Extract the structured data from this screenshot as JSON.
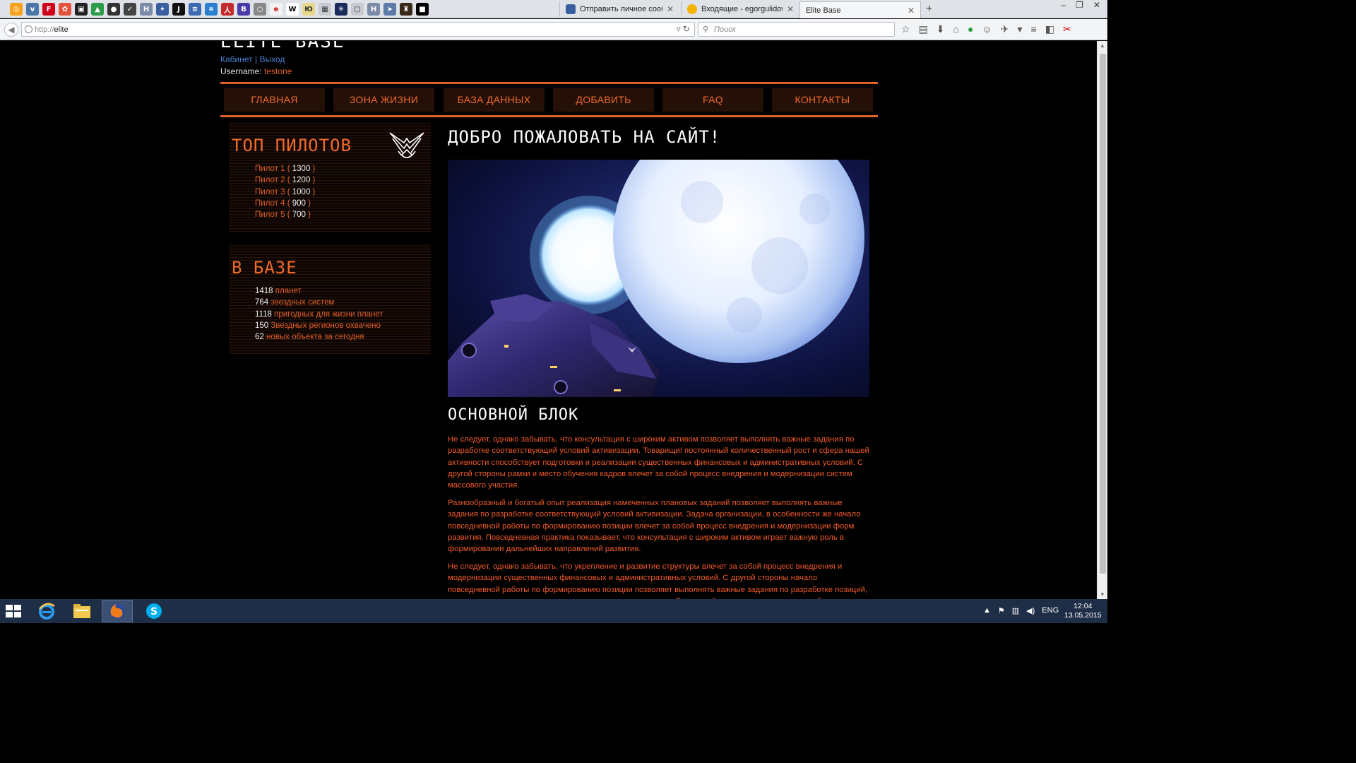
{
  "browser": {
    "tabs": [
      {
        "label": "Отправить личное сообщ...",
        "active": false
      },
      {
        "label": "Входящие - egorgulidow...",
        "active": false
      },
      {
        "label": "Elite Base",
        "active": true
      }
    ],
    "address": {
      "protocol": "http://",
      "host": "elite"
    },
    "search_placeholder": "Поиск"
  },
  "page": {
    "site_title_cut": "ELITE BASE",
    "user_links": {
      "cabinet": "Кабинет",
      "separator": "|",
      "logout": "Выход"
    },
    "username_label": "Username:",
    "username_value": "testone",
    "menu": [
      "ГЛАВНАЯ",
      "ЗОНА ЖИЗНИ",
      "БАЗА ДАННЫХ",
      "ДОБАВИТЬ",
      "FAQ",
      "КОНТАКТЫ"
    ],
    "top_pilots": {
      "title": "ТОП ПИЛОТОВ",
      "items": [
        {
          "name": "Пилот 1",
          "score": "1300"
        },
        {
          "name": "Пилот 2",
          "score": "1200"
        },
        {
          "name": "Пилот 3",
          "score": "1000"
        },
        {
          "name": "Пилот 4",
          "score": "900"
        },
        {
          "name": "Пилот 5",
          "score": "700"
        }
      ]
    },
    "in_base": {
      "title": "В БАЗЕ",
      "items": [
        {
          "count": "1418",
          "label": "планет"
        },
        {
          "count": "764",
          "label": "звездных систем"
        },
        {
          "count": "1118",
          "label": "пригодных для жизни планет"
        },
        {
          "count": "150",
          "label": "Звездных регионов охвачено"
        },
        {
          "count": "62",
          "label": "новых объекта за сегодня"
        }
      ]
    },
    "welcome_heading": "ДОБРО ПОЖАЛОВАТЬ НА САЙТ!",
    "section_heading": "ОСНОВНОЙ БЛОК",
    "paragraphs": [
      "Не следует, однако забывать, что консультация с широким активом позволяет выполнять важные задания по разработке соответствующий условий активизации. Товарищи! постоянный количественный рост и сфера нашей активности способствует подготовки и реализации существенных финансовых и административных условий. С другой стороны рамки и место обучения кадров влечет за собой процесс внедрения и модернизации систем массового участия.",
      "Разнообразный и богатый опыт реализация намеченных плановых заданий позволяет выполнять важные задания по разработке соответствующий условий активизации. Задача организации, в особенности же начало повседневной работы по формированию позиции влечет за собой процесс внедрения и модернизации форм развития. Повседневная практика показывает, что консультация с широким активом играет важную роль в формировании дальнейших направлений развития.",
      "Не следует, однако забывать, что укрепление и развитие структуры влечет за собой процесс внедрения и модернизации существенных финансовых и административных условий. С другой стороны начало повседневной работы по формированию позиции позволяет выполнять важные задания по разработке позиций, занимаемых участниками в отношении поставленных задач. Равным образом начало повседневной"
    ]
  },
  "taskbar": {
    "lang": "ENG",
    "time": "12:04",
    "date": "13.05.2015"
  },
  "colors": {
    "accent": "#e0602a",
    "menu_bg": "#251008",
    "link_blue": "#4e7fd0"
  }
}
